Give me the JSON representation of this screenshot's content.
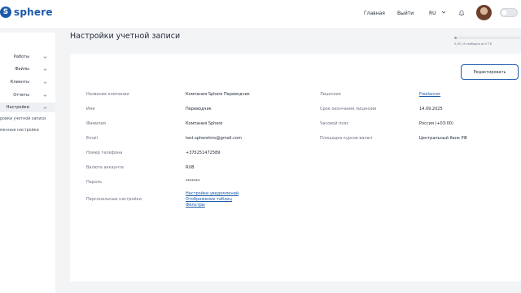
{
  "app": {
    "logo_text": "sphere",
    "logo_letter": "S"
  },
  "header": {
    "nav": [
      {
        "label": "Главная"
      },
      {
        "label": "Выйти"
      }
    ],
    "language": "RU"
  },
  "sidebar": {
    "items": [
      {
        "label": "Работы"
      },
      {
        "label": "Файлы"
      },
      {
        "label": "Клиенты"
      },
      {
        "label": "Отчеты"
      },
      {
        "label": "Настройки"
      }
    ],
    "subitems": [
      {
        "label": "ройки учетной записи"
      },
      {
        "label": "менные настройки"
      }
    ]
  },
  "main": {
    "title": "Настройки учетной записи",
    "storage": {
      "text": "0,00 / 6 свободно из 0 ТБ",
      "fraction": 0.04
    },
    "edit_label": "Редактировать",
    "left_fields": [
      {
        "label": "Название компании",
        "value": "Компания Sphere Переводчик"
      },
      {
        "label": "Имя",
        "value": "Переводчик"
      },
      {
        "label": "Фамилия",
        "value": "Компания Sphere"
      },
      {
        "label": "Email",
        "value": "test.spheretms@gmail.com"
      },
      {
        "label": "Номер телефона",
        "value": "+375251472589"
      },
      {
        "label": "Валюта аккаунта",
        "value": "RUB"
      },
      {
        "label": "Пароль",
        "value": "*******"
      }
    ],
    "personal": {
      "label": "Персональные настройки",
      "links": [
        {
          "label": "Настройки уведомлений"
        },
        {
          "label": "Отображение таблиц"
        },
        {
          "label": "Фильтры"
        }
      ]
    },
    "right_fields": [
      {
        "label": "Лицензия",
        "value": "Freelancer"
      },
      {
        "label": "Срок окончания лицензии",
        "value": "14.09.2025"
      },
      {
        "label": "Часовой пояс",
        "value": "Россия (+03:00)"
      },
      {
        "label": "Площадка курсов валют",
        "value": "Центральный банк РФ"
      }
    ]
  },
  "colors": {
    "brand": "#1b5aa8",
    "background": "#f3f4f6",
    "card": "#ffffff"
  }
}
